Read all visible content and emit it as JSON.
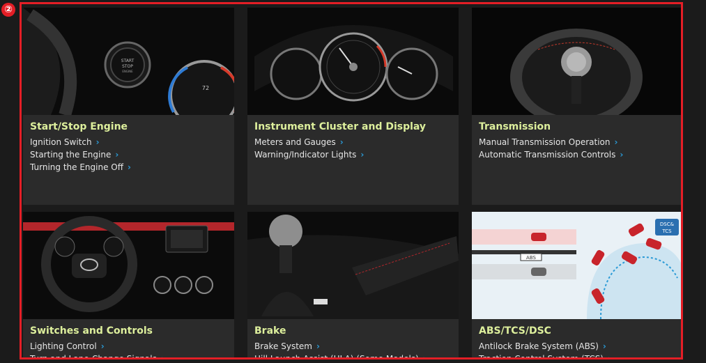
{
  "marker": "②",
  "cards": [
    {
      "title": "Start/Stop Engine",
      "items": [
        "Ignition Switch",
        "Starting the Engine",
        "Turning the Engine Off"
      ]
    },
    {
      "title": "Instrument Cluster and Display",
      "items": [
        "Meters and Gauges",
        "Warning/Indicator Lights"
      ]
    },
    {
      "title": "Transmission",
      "items": [
        "Manual Transmission Operation",
        "Automatic Transmission Controls"
      ]
    },
    {
      "title": "Switches and Controls",
      "items": [
        "Lighting Control",
        "Turn and Lane-Change Signals"
      ]
    },
    {
      "title": "Brake",
      "items": [
        "Brake System",
        "Hill Launch Assist (HLA) (Some Models)"
      ]
    },
    {
      "title": "ABS/TCS/DSC",
      "items": [
        "Antilock Brake System (ABS)",
        "Traction Control System (TCS)"
      ]
    }
  ],
  "images": {
    "start_stop_text": "START STOP ENGINE",
    "abs_label": "ABS",
    "dsc_tcs_label": "DSC& TCS"
  },
  "colors": {
    "frame": "#e41e26",
    "title": "#ddef9c",
    "chevron": "#2a9ad6",
    "card_bg": "#2b2b2b"
  }
}
